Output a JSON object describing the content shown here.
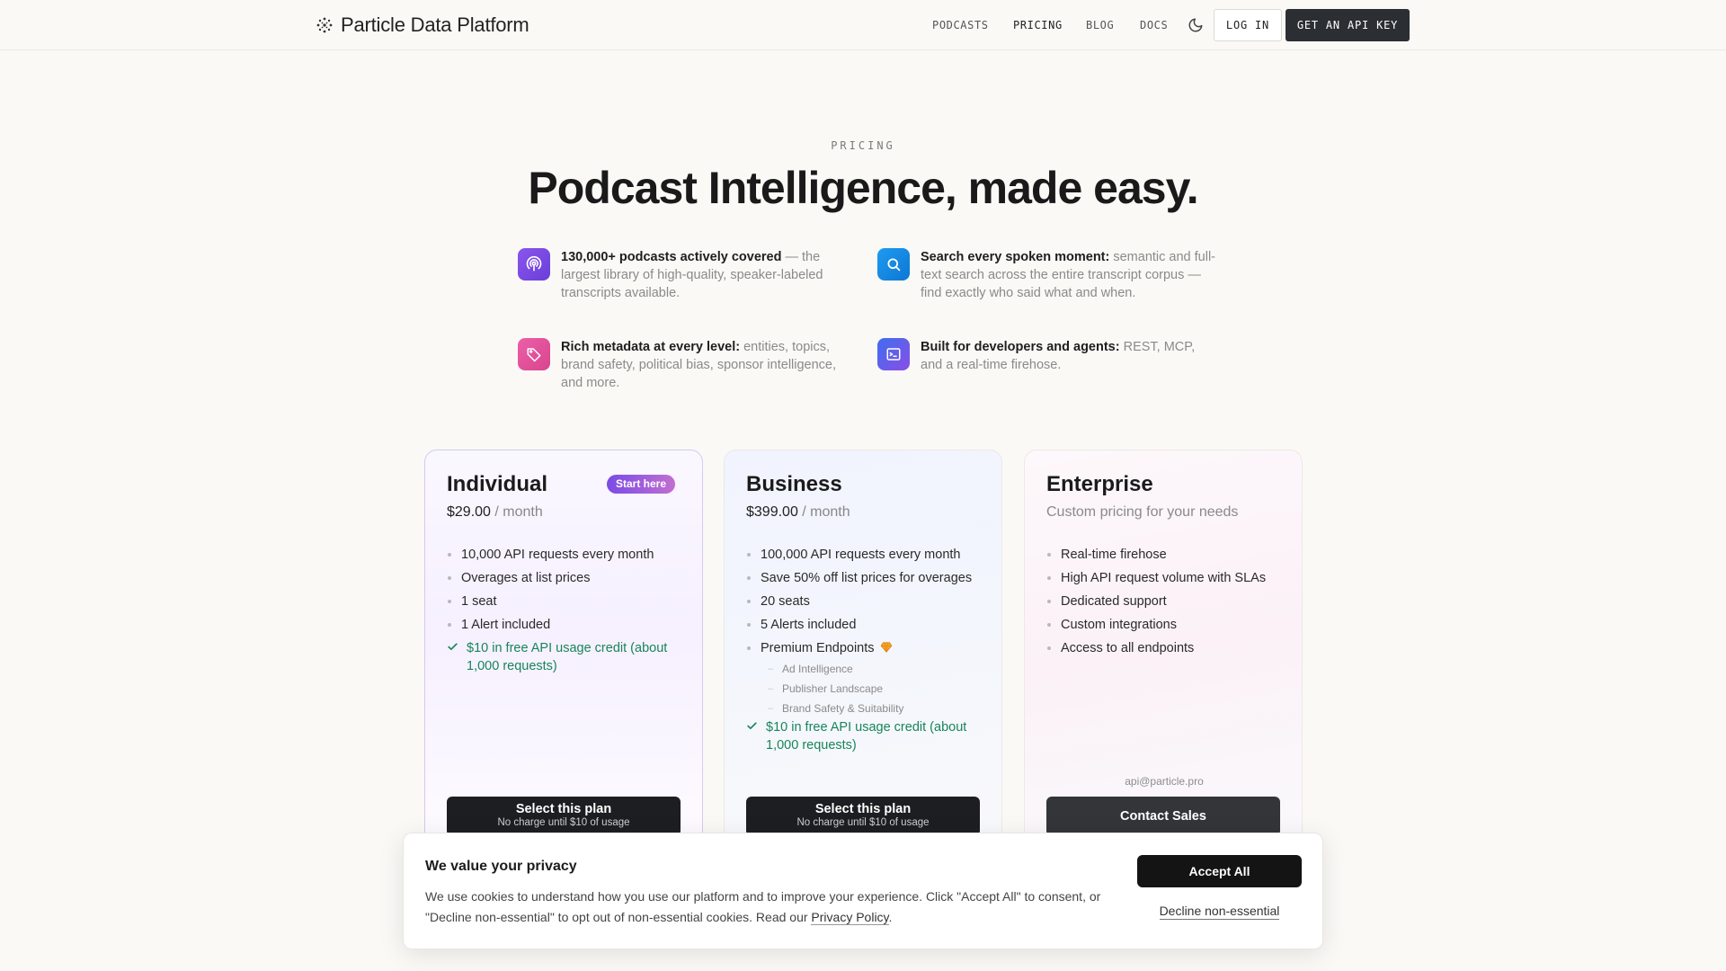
{
  "header": {
    "logo_text": "Particle Data Platform",
    "nav": {
      "podcasts": "PODCASTS",
      "pricing": "PRICING",
      "blog": "BLOG",
      "docs": "DOCS"
    },
    "login_label": "LOG IN",
    "api_key_label": "GET AN API KEY"
  },
  "hero": {
    "eyebrow": "PRICING",
    "title": "Podcast Intelligence, made easy."
  },
  "features": [
    {
      "icon": "podcast-icon",
      "bold": "130,000+ podcasts actively covered",
      "text": " — the largest library of high-quality, speaker-labeled transcripts available.",
      "color": "#7c4ee4"
    },
    {
      "icon": "search-icon",
      "bold": "Search every spoken moment:",
      "text": " semantic and full-text search across the entire transcript corpus — find exactly who said what and when.",
      "color": "#1689e0"
    },
    {
      "icon": "tag-icon",
      "bold": "Rich metadata at every level:",
      "text": " entities, topics, brand safety, political bias, sponsor intelligence, and more.",
      "color": "#e0509c"
    },
    {
      "icon": "terminal-icon",
      "bold": "Built for developers and agents:",
      "text": " REST, MCP, and a real-time firehose.",
      "color": "#5a52e0"
    }
  ],
  "plans": {
    "individual": {
      "name": "Individual",
      "badge": "Start here",
      "price": "$29.00",
      "period": " / month",
      "items": [
        "10,000 API requests every month",
        "Overages at list prices",
        "1 seat",
        "1 Alert included"
      ],
      "credit": "$10 in free API usage credit (about 1,000 requests)",
      "cta": "Select this plan",
      "cta_sub": "No charge until $10 of usage"
    },
    "business": {
      "name": "Business",
      "price": "$399.00",
      "period": " / month",
      "items": [
        "100,000 API requests every month",
        "Save 50% off list prices for overages",
        "20 seats",
        "5 Alerts included",
        "Premium Endpoints"
      ],
      "premium_sub": [
        "Ad Intelligence",
        "Publisher Landscape",
        "Brand Safety & Suitability"
      ],
      "credit": "$10 in free API usage credit (about 1,000 requests)",
      "cta": "Select this plan",
      "cta_sub": "No charge until $10 of usage"
    },
    "enterprise": {
      "name": "Enterprise",
      "price_text": "Custom pricing for your needs",
      "items": [
        "Real-time firehose",
        "High API request volume with SLAs",
        "Dedicated support",
        "Custom integrations",
        "Access to all endpoints"
      ],
      "email": "api@particle.pro",
      "cta": "Contact Sales"
    }
  },
  "cookie": {
    "title": "We value your privacy",
    "text_before": "We use cookies to understand how you use our platform and to improve your experience. Click \"Accept All\" to consent, or \"Decline non-essential\" to opt out of non-essential cookies. Read our ",
    "link": "Privacy Policy",
    "text_after": ".",
    "accept": "Accept All",
    "decline": "Decline non-essential"
  },
  "colors": {
    "accent_dark": "#2b2e33",
    "credit_green": "#17855a",
    "badge_gradient": [
      "#7b4be6",
      "#c16fd0"
    ]
  }
}
